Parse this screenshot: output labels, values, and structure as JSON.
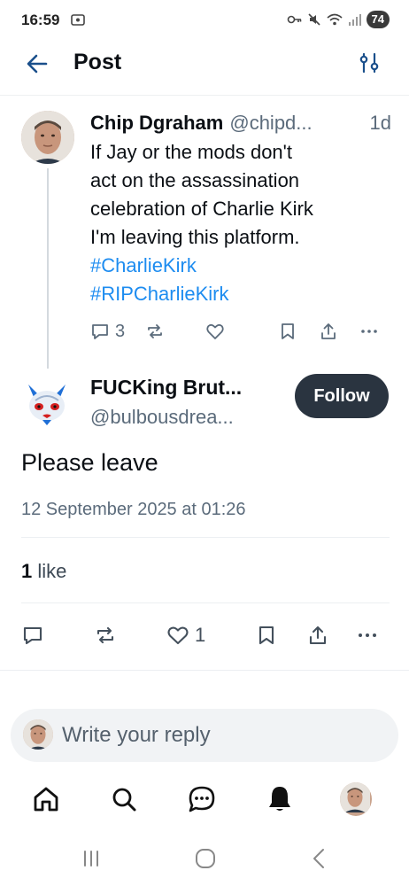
{
  "status_bar": {
    "time": "16:59",
    "battery": "74",
    "icons": [
      "screenshot-icon",
      "key-icon",
      "mute-icon",
      "wifi-icon",
      "signal-icon",
      "battery-icon"
    ]
  },
  "header": {
    "title": "Post",
    "back_icon": "arrow-left-icon",
    "filter_icon": "sliders-icon"
  },
  "parent_post": {
    "author_name": "Chip Dgraham",
    "author_handle": "@chipd...",
    "time_ago": "1d",
    "text_lines": [
      "If Jay or the mods don't",
      "act on the assassination",
      "celebration of Charlie Kirk",
      "I'm leaving this platform."
    ],
    "hashtags": [
      "#CharlieKirk",
      "#RIPCharlieKirk"
    ],
    "reply_count": "3",
    "actions": [
      "reply-icon",
      "repost-icon",
      "like-icon",
      "bookmark-icon",
      "share-icon",
      "more-icon"
    ]
  },
  "reply_post": {
    "author_name": "FUCKing Brut...",
    "author_handle": "@bulbousdrea...",
    "follow_label": "Follow",
    "text": "Please leave",
    "timestamp": "12 September 2025 at 01:26",
    "like_count_label": "1",
    "like_word": "like",
    "like_count": "1"
  },
  "composer": {
    "placeholder": "Write your reply"
  },
  "bottom_nav": {
    "items": [
      "home-icon",
      "search-icon",
      "chat-icon",
      "notifications-icon",
      "profile-avatar"
    ]
  },
  "system_nav": {
    "items": [
      "recents-icon",
      "home-circle-icon",
      "back-chevron-icon"
    ]
  },
  "colors": {
    "link": "#1d8cf0",
    "follow_bg": "#2a3440",
    "muted_text": "#5b6b7b",
    "composer_bg": "#f1f3f5"
  }
}
